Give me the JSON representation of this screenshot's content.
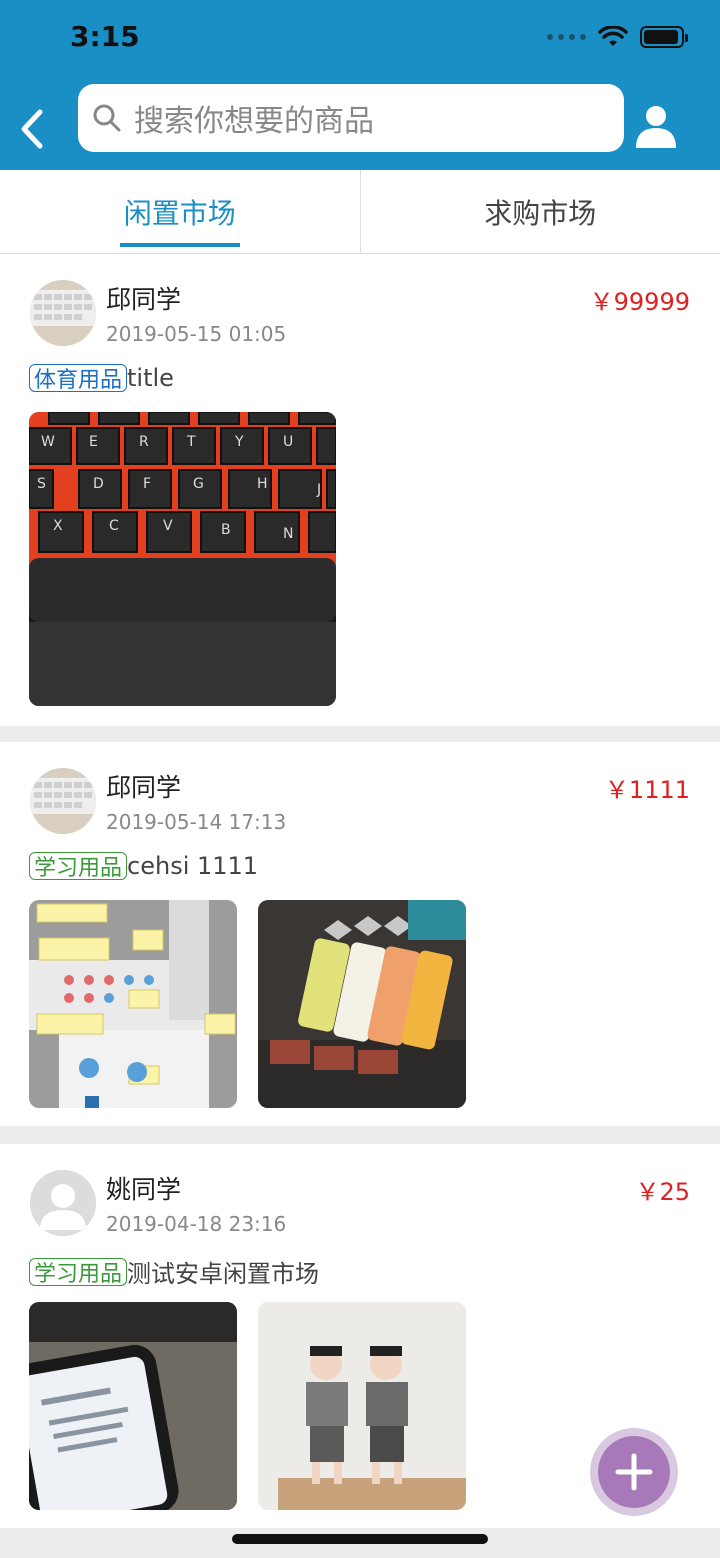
{
  "status": {
    "time": "3:15"
  },
  "search": {
    "placeholder": "搜索你想要的商品"
  },
  "tabs": [
    {
      "label": "闲置市场",
      "active": true
    },
    {
      "label": "求购市场",
      "active": false
    }
  ],
  "posts": [
    {
      "user": "邱同学",
      "date": "2019-05-15 01:05",
      "price": "￥99999",
      "tag": "体育用品",
      "tag_color": "#1a6fc6",
      "title": "title",
      "images": [
        "keyboard-photo"
      ]
    },
    {
      "user": "邱同学",
      "date": "2019-05-14 17:13",
      "price": "￥1111",
      "tag": "学习用品",
      "tag_color": "#3a9a3a",
      "title": "cehsi 1111",
      "images": [
        "screenshot-photo",
        "seal-stamps-photo"
      ]
    },
    {
      "user": "姚同学",
      "date": "2019-04-18 23:16",
      "price": "￥25",
      "tag": "学习用品",
      "tag_color": "#3a9a3a",
      "title": "测试安卓闲置市场",
      "images": [
        "phone-photo",
        "children-photo"
      ]
    }
  ],
  "colors": {
    "header": "#1a8fc6",
    "price": "#e02020",
    "fab": "#a779b8"
  }
}
